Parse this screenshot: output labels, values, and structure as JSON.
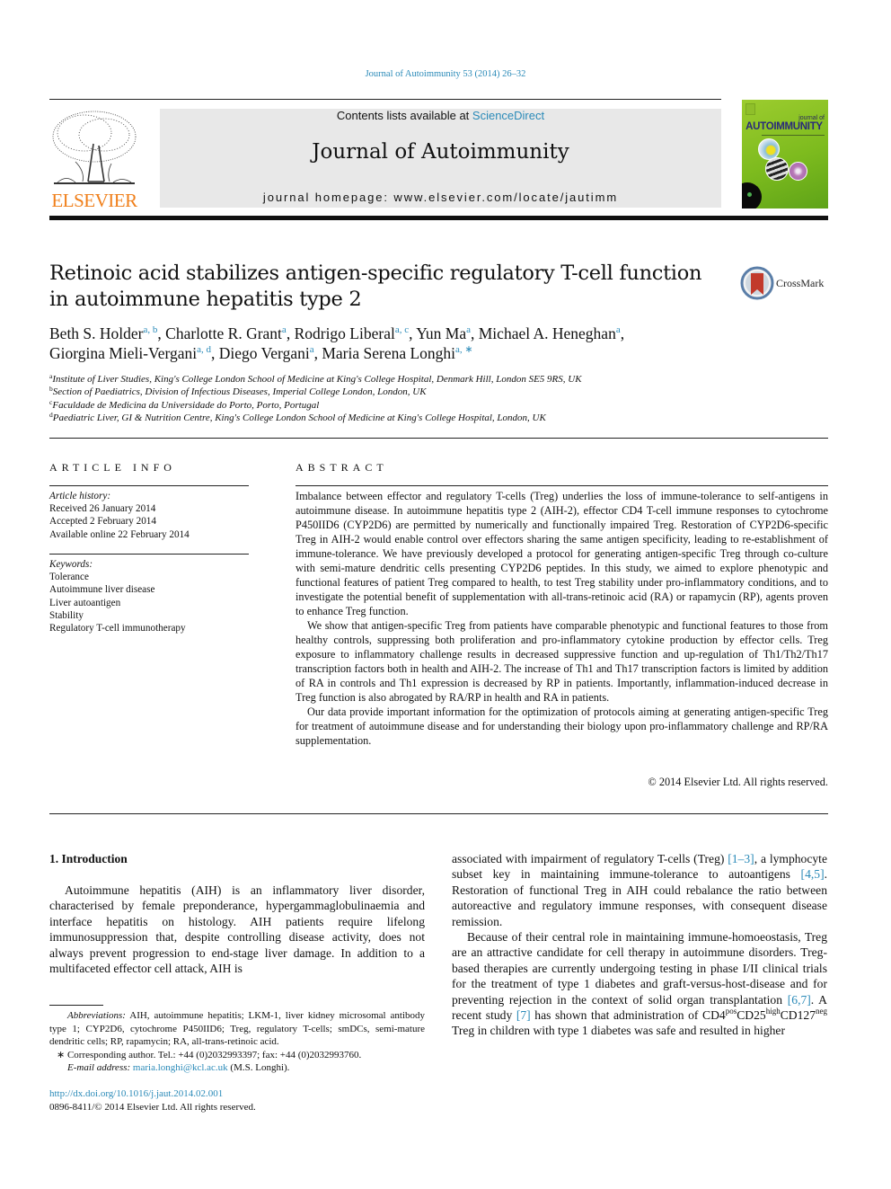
{
  "header": {
    "citation": "Journal of Autoimmunity 53 (2014) 26–32",
    "publisher_wordmark": "ELSEVIER",
    "contents_prefix": "Contents lists available at ",
    "contents_link": "ScienceDirect",
    "journal_title": "Journal of Autoimmunity",
    "homepage_prefix": "journal homepage: ",
    "homepage_url": "www.elsevier.com/locate/jautimm",
    "cover": {
      "small_title": "journal of",
      "big_title": "AUTOIMMUNITY"
    },
    "crossmark_label": "CrossMark"
  },
  "article": {
    "title_line1": "Retinoic acid stabilizes antigen-specific regulatory T-cell function",
    "title_line2": "in autoimmune hepatitis type 2",
    "authors": [
      {
        "name": "Beth S. Holder",
        "aff": "a, b",
        "sep": ", "
      },
      {
        "name": "Charlotte R. Grant",
        "aff": "a",
        "sep": ", "
      },
      {
        "name": "Rodrigo Liberal",
        "aff": "a, c",
        "sep": ", "
      },
      {
        "name": "Yun Ma",
        "aff": "a",
        "sep": ", "
      },
      {
        "name": "Michael A. Heneghan",
        "aff": "a",
        "sep": ","
      },
      {
        "name": "Giorgina Mieli-Vergani",
        "aff": "a, d",
        "sep": ", "
      },
      {
        "name": "Diego Vergani",
        "aff": "a",
        "sep": ", "
      },
      {
        "name": "Maria Serena Longhi",
        "aff": "a, ∗",
        "sep": ""
      }
    ],
    "affiliations": [
      {
        "key": "a",
        "text": "Institute of Liver Studies, King's College London School of Medicine at King's College Hospital, Denmark Hill, London SE5 9RS, UK"
      },
      {
        "key": "b",
        "text": "Section of Paediatrics, Division of Infectious Diseases, Imperial College London, London, UK"
      },
      {
        "key": "c",
        "text": "Faculdade de Medicina da Universidade do Porto, Porto, Portugal"
      },
      {
        "key": "d",
        "text": "Paediatric Liver, GI & Nutrition Centre, King's College London School of Medicine at King's College Hospital, London, UK"
      }
    ]
  },
  "article_info": {
    "heading": "ARTICLE INFO",
    "history_label": "Article history:",
    "history": [
      "Received 26 January 2014",
      "Accepted 2 February 2014",
      "Available online 22 February 2014"
    ],
    "keywords_label": "Keywords:",
    "keywords": [
      "Tolerance",
      "Autoimmune liver disease",
      "Liver autoantigen",
      "Stability",
      "Regulatory T-cell immunotherapy"
    ]
  },
  "abstract": {
    "heading": "ABSTRACT",
    "paragraphs": [
      "Imbalance between effector and regulatory T-cells (Treg) underlies the loss of immune-tolerance to self-antigens in autoimmune disease. In autoimmune hepatitis type 2 (AIH-2), effector CD4 T-cell immune responses to cytochrome P450IID6 (CYP2D6) are permitted by numerically and functionally impaired Treg. Restoration of CYP2D6-specific Treg in AIH-2 would enable control over effectors sharing the same antigen specificity, leading to re-establishment of immune-tolerance. We have previously developed a protocol for generating antigen-specific Treg through co-culture with semi-mature dendritic cells presenting CYP2D6 peptides. In this study, we aimed to explore phenotypic and functional features of patient Treg compared to health, to test Treg stability under pro-inflammatory conditions, and to investigate the potential benefit of supplementation with all-trans-retinoic acid (RA) or rapamycin (RP), agents proven to enhance Treg function.",
      "We show that antigen-specific Treg from patients have comparable phenotypic and functional features to those from healthy controls, suppressing both proliferation and pro-inflammatory cytokine production by effector cells. Treg exposure to inflammatory challenge results in decreased suppressive function and up-regulation of Th1/Th2/Th17 transcription factors both in health and AIH-2. The increase of Th1 and Th17 transcription factors is limited by addition of RA in controls and Th1 expression is decreased by RP in patients. Importantly, inflammation-induced decrease in Treg function is also abrogated by RA/RP in health and RA in patients.",
      "Our data provide important information for the optimization of protocols aiming at generating antigen-specific Treg for treatment of autoimmune disease and for understanding their biology upon pro-inflammatory challenge and RP/RA supplementation."
    ],
    "copyright": "© 2014 Elsevier Ltd. All rights reserved."
  },
  "introduction": {
    "heading": "1.  Introduction",
    "left_paragraph": "Autoimmune hepatitis (AIH) is an inflammatory liver disorder, characterised by female preponderance, hypergammaglobulinaemia and interface hepatitis on histology. AIH patients require lifelong immunosuppression that, despite controlling disease activity, does not always prevent progression to end-stage liver damage. In addition to a multifaceted effector cell attack, AIH is",
    "right_p1": {
      "t1": "associated with impairment of regulatory T-cells (Treg) ",
      "ref1": "[1–3]",
      "t2": ", a lymphocyte subset key in maintaining immune-tolerance to autoantigens ",
      "ref2": "[4,5]",
      "t3": ". Restoration of functional Treg in AIH could rebalance the ratio between autoreactive and regulatory immune responses, with consequent disease remission."
    },
    "right_p2": {
      "t1": "Because of their central role in maintaining immune-homoeostasis, Treg are an attractive candidate for cell therapy in autoimmune disorders. Treg-based therapies are currently undergoing testing in phase I/II clinical trials for the treatment of type 1 diabetes and graft-versus-host-disease and for preventing rejection in the context of solid organ transplantation ",
      "ref1": "[6,7]",
      "t2": ". A recent study ",
      "ref2": "[7]",
      "t3": " has shown that administration of CD4",
      "sup1": "pos",
      "t4": "CD25",
      "sup2": "high",
      "t5": "CD127",
      "sup3": "neg",
      "t6": " Treg in children with type 1 diabetes was safe and resulted in higher"
    }
  },
  "footnotes": {
    "abbrev_label": "Abbreviations:",
    "abbrev_text": " AIH, autoimmune hepatitis; LKM-1, liver kidney microsomal antibody type 1; CYP2D6, cytochrome P450IID6; Treg, regulatory T-cells; smDCs, semi-mature dendritic cells; RP, rapamycin; RA, all-trans-retinoic acid.",
    "corresponding": "∗  Corresponding author. Tel.: +44 (0)2032993397; fax: +44 (0)2032993760.",
    "email_label": "E-mail address:",
    "email": "maria.longhi@kcl.ac.uk",
    "email_suffix": " (M.S. Longhi).",
    "doi": "http://dx.doi.org/10.1016/j.jaut.2014.02.001",
    "issn": "0896-8411/© 2014 Elsevier Ltd. All rights reserved."
  }
}
